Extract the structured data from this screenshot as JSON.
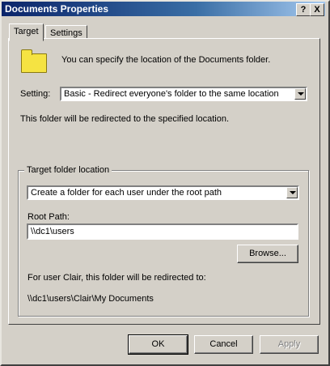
{
  "window": {
    "title": "Documents Properties"
  },
  "title_buttons": {
    "help": "?",
    "close": "X"
  },
  "tabs": [
    {
      "label": "Target"
    },
    {
      "label": "Settings"
    }
  ],
  "intro_text": "You can specify the location of the Documents folder.",
  "setting": {
    "label": "Setting:",
    "value": "Basic - Redirect everyone's folder to the same location"
  },
  "redirect_note": "This folder will be redirected to the specified location.",
  "target_group": {
    "label": "Target folder location",
    "option_value": "Create a folder for each user under the root path",
    "root_path_label": "Root Path:",
    "root_path_value": "\\\\dc1\\users",
    "browse_label": "Browse...",
    "user_note": "For user Clair, this folder will be redirected to:",
    "redirect_path": "\\\\dc1\\users\\Clair\\My Documents"
  },
  "buttons": {
    "ok": "OK",
    "cancel": "Cancel",
    "apply": "Apply"
  }
}
